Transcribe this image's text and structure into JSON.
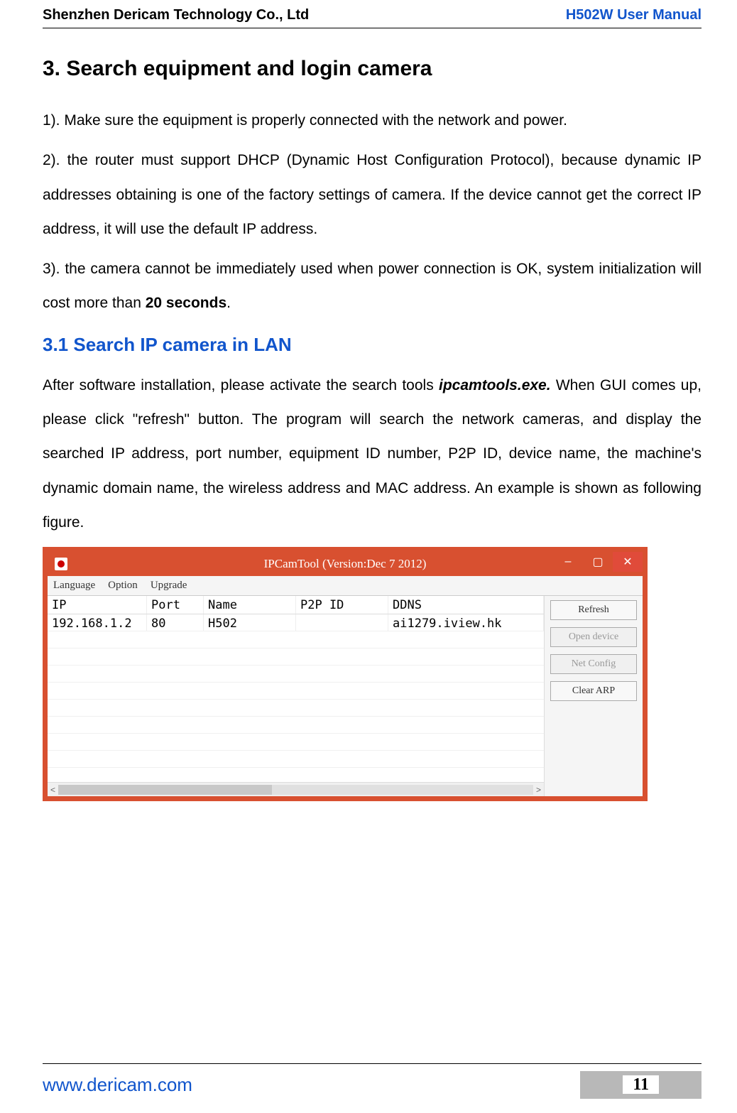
{
  "header": {
    "company": "Shenzhen Dericam Technology Co., Ltd",
    "manual": "H502W User Manual"
  },
  "section": {
    "title": "3. Search equipment and login camera",
    "p1": "1). Make sure the equipment is properly connected with the network and power.",
    "p2": "2). the router must support DHCP (Dynamic Host Configuration Protocol), because dynamic IP addresses obtaining is one of the factory settings of camera. If the device cannot get the correct IP address, it will use the default IP address.",
    "p3_prefix": "3). the camera cannot be immediately used when power connection is OK, system initialization will cost more than ",
    "p3_bold": "20 seconds",
    "p3_suffix": "."
  },
  "subsection": {
    "title": "3.1 Search IP camera in LAN",
    "p_prefix": " After software installation, please activate the search tools ",
    "p_tool": "ipcamtools.exe.",
    "p_suffix": " When GUI comes up, please click \"refresh\" button. The program will search the network cameras, and display the searched IP address, port number, equipment ID number, P2P ID, device name, the machine's dynamic domain name, the wireless address and MAC address. An example is shown as following figure."
  },
  "app": {
    "title": "IPCamTool (Version:Dec  7 2012)",
    "menu": {
      "language": "Language",
      "option": "Option",
      "upgrade": "Upgrade"
    },
    "columns": {
      "ip": "IP",
      "port": "Port",
      "name": "Name",
      "p2p": "P2P ID",
      "ddns": "DDNS"
    },
    "row": {
      "ip": "192.168.1.2",
      "port": "80",
      "name": "H502",
      "p2p": "",
      "ddns": "ai1279.iview.hk"
    },
    "buttons": {
      "refresh": "Refresh",
      "open": "Open device",
      "netconfig": "Net Config",
      "cleararp": "Clear ARP"
    }
  },
  "footer": {
    "url": "www.dericam.com",
    "page": "11"
  }
}
